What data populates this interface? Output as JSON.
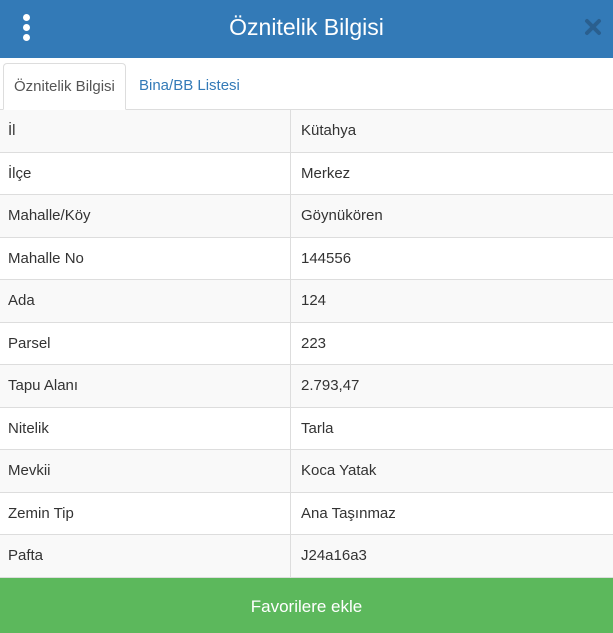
{
  "header": {
    "title": "Öznitelik Bilgisi",
    "menu_icon": "kebab-menu-icon",
    "close_icon": "close-icon",
    "color": "#337ab7"
  },
  "tabs": [
    {
      "label": "Öznitelik Bilgisi",
      "active": true
    },
    {
      "label": "Bina/BB Listesi",
      "active": false
    }
  ],
  "attributes": [
    {
      "key": "İl",
      "value": "Kütahya"
    },
    {
      "key": "İlçe",
      "value": "Merkez"
    },
    {
      "key": "Mahalle/Köy",
      "value": "Göynükören"
    },
    {
      "key": "Mahalle No",
      "value": "144556"
    },
    {
      "key": "Ada",
      "value": "124"
    },
    {
      "key": "Parsel",
      "value": "223"
    },
    {
      "key": "Tapu Alanı",
      "value": "2.793,47"
    },
    {
      "key": "Nitelik",
      "value": "Tarla"
    },
    {
      "key": "Mevkii",
      "value": "Koca Yatak"
    },
    {
      "key": "Zemin Tip",
      "value": "Ana Taşınmaz"
    },
    {
      "key": "Pafta",
      "value": "J24a16a3"
    }
  ],
  "footer": {
    "favorite_label": "Favorilere ekle",
    "color": "#5cb85c"
  }
}
